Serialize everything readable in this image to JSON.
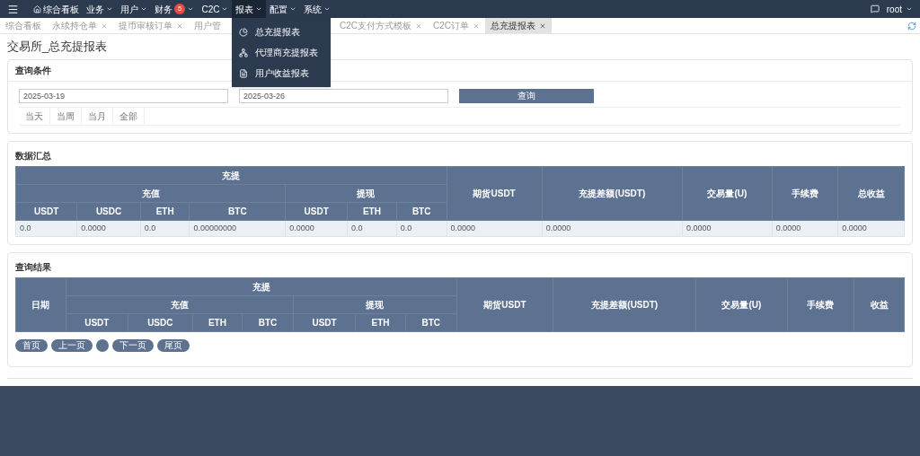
{
  "navbar": {
    "items": [
      {
        "label": "综合看板",
        "kind": "home",
        "open": false
      },
      {
        "label": "业务",
        "kind": "menu",
        "open": false
      },
      {
        "label": "用户",
        "kind": "menu",
        "open": false
      },
      {
        "label": "财务",
        "kind": "menu",
        "badge": "5",
        "open": false
      },
      {
        "label": "C2C",
        "kind": "menu",
        "open": false
      },
      {
        "label": "报表",
        "kind": "menu",
        "open": true
      },
      {
        "label": "配置",
        "kind": "menu",
        "open": false
      },
      {
        "label": "系统",
        "kind": "menu",
        "open": false
      }
    ],
    "user": "root",
    "dropdown": [
      {
        "label": "总充提报表",
        "kind": "pie"
      },
      {
        "label": "代理商充提报表",
        "kind": "org"
      },
      {
        "label": "用户收益报表",
        "kind": "doc"
      }
    ]
  },
  "tabs": [
    {
      "label": "综合看板",
      "closable": false,
      "selected": false
    },
    {
      "label": "永续持仓单",
      "closable": true,
      "selected": false
    },
    {
      "label": "提币审核订单",
      "closable": true,
      "selected": false
    },
    {
      "label": "用户管",
      "closable": false,
      "selected": false
    },
    {
      "label": "C2C支付方式模板",
      "closable": true,
      "selected": false
    },
    {
      "label": "C2C订单",
      "closable": true,
      "selected": false
    },
    {
      "label": "总充提报表",
      "closable": true,
      "selected": true
    }
  ],
  "page_title": "交易所_总充提报表",
  "query": {
    "title": "查询条件",
    "start_date": "2025-03-19",
    "end_date": "2025-03-26",
    "button": "查询",
    "ranges": [
      {
        "label": "当天",
        "selected": false
      },
      {
        "label": "当周",
        "selected": false
      },
      {
        "label": "当月",
        "selected": false
      },
      {
        "label": "全部",
        "selected": false
      }
    ]
  },
  "summary": {
    "title": "数据汇总",
    "group": "充提",
    "deposit": "充值",
    "withdraw": "提现",
    "deposit_cols": [
      "USDT",
      "USDC",
      "ETH",
      "BTC"
    ],
    "withdraw_cols": [
      "USDT",
      "ETH",
      "BTC"
    ],
    "extra_cols": [
      "期货USDT",
      "充提差额(USDT)",
      "交易量(U)",
      "手续费",
      "总收益"
    ],
    "row": [
      "0.0",
      "0.0000",
      "0.0",
      "0.00000000",
      "0.0000",
      "0.0",
      "0.0",
      "0.0000",
      "0.0000",
      "0.0000",
      "0.0000",
      "0.0000"
    ]
  },
  "results": {
    "title": "查询结果",
    "date_col": "日期",
    "group": "充提",
    "deposit": "充值",
    "withdraw": "提现",
    "deposit_cols": [
      "USDT",
      "USDC",
      "ETH",
      "BTC"
    ],
    "withdraw_cols": [
      "USDT",
      "ETH",
      "BTC"
    ],
    "extra_cols": [
      "期货USDT",
      "充提差额(USDT)",
      "交易量(U)",
      "手续费",
      "收益"
    ]
  },
  "pagination": [
    {
      "kind": "link",
      "label": "首页"
    },
    {
      "kind": "link",
      "label": "上一页"
    },
    {
      "kind": "page"
    },
    {
      "kind": "link",
      "label": "下一页"
    },
    {
      "kind": "link",
      "label": "尾页"
    }
  ]
}
